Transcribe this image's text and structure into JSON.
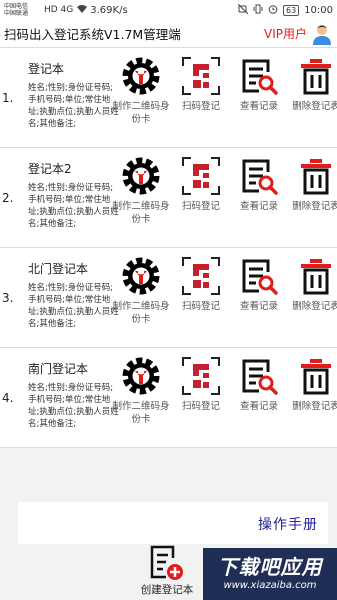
{
  "status_bar": {
    "carrier_1": "中国电信",
    "carrier_2": "中国联通",
    "signal": "HD 4G",
    "net_speed": "3.69K/s",
    "battery": "63",
    "time": "10:00"
  },
  "header": {
    "title": "扫码出入登记系统V1.7M管理端",
    "vip_label": "VIP用户"
  },
  "actions": {
    "qr_card": "制作二维码身份卡",
    "scan": "扫码登记",
    "view": "查看记录",
    "delete": "删除登记表"
  },
  "books": [
    {
      "index": "1.",
      "name": "登记本",
      "fields": "姓名;性别;身份证号码;手机号码;单位;常住地址;执勤点位;执勤人员姓名;其他备注;"
    },
    {
      "index": "2.",
      "name": "登记本2",
      "fields": "姓名;性别;身份证号码;手机号码;单位;常住地址;执勤点位;执勤人员姓名;其他备注;"
    },
    {
      "index": "3.",
      "name": "北门登记本",
      "fields": "姓名;性别;身份证号码;手机号码;单位;常住地址;执勤点位;执勤人员姓名;其他备注;"
    },
    {
      "index": "4.",
      "name": "南门登记本",
      "fields": "姓名;性别;身份证号码;手机号码;单位;常住地址;执勤点位;执勤人员姓名;其他备注;"
    }
  ],
  "footer": {
    "manual": "操作手册",
    "create": "创建登记本"
  },
  "watermark": {
    "main": "下载吧应用",
    "sub": "www.xiazaiba.com"
  },
  "colors": {
    "accent_red": "#e21b1b",
    "link_blue": "#23209a"
  }
}
